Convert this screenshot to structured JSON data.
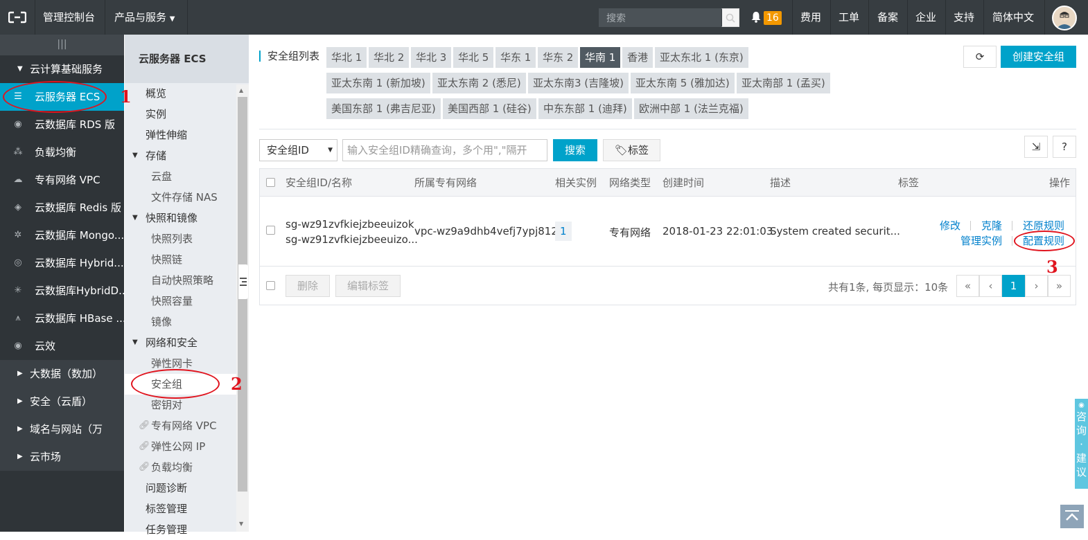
{
  "topbar": {
    "console": "管理控制台",
    "products": "产品与服务",
    "search_placeholder": "搜索",
    "badge_count": "16",
    "links": [
      "费用",
      "工单",
      "备案",
      "企业",
      "支持",
      "简体中文"
    ]
  },
  "leftnav": {
    "grip": "|||",
    "group_title": "云计算基础服务",
    "items": [
      {
        "label": "云服务器 ECS",
        "icon": "server-icon"
      },
      {
        "label": "云数据库 RDS 版",
        "icon": "database-icon"
      },
      {
        "label": "负载均衡",
        "icon": "load-balance-icon"
      },
      {
        "label": "专有网络 VPC",
        "icon": "cloud-icon"
      },
      {
        "label": "云数据库 Redis 版",
        "icon": "redis-icon"
      },
      {
        "label": "云数据库 Mongo...",
        "icon": "mongo-icon"
      },
      {
        "label": "云数据库 Hybrid...",
        "icon": "hybrid-icon"
      },
      {
        "label": "云数据库HybridD...",
        "icon": "hybrid-db-icon"
      },
      {
        "label": "云数据库 HBase ...",
        "icon": "hbase-icon"
      },
      {
        "label": "云效",
        "icon": "eye-icon"
      }
    ],
    "groups": [
      "大数据（数加）",
      "安全（云盾）",
      "域名与网站（万",
      "云市场"
    ]
  },
  "subnav": {
    "title": "云服务器 ECS",
    "items": [
      {
        "label": "概览",
        "level": 1
      },
      {
        "label": "实例",
        "level": 1
      },
      {
        "label": "弹性伸缩",
        "level": 1
      },
      {
        "label": "存储",
        "level": 1,
        "expanded": true
      },
      {
        "label": "云盘",
        "level": 2
      },
      {
        "label": "文件存储 NAS",
        "level": 2
      },
      {
        "label": "快照和镜像",
        "level": 1,
        "expanded": true
      },
      {
        "label": "快照列表",
        "level": 2
      },
      {
        "label": "快照链",
        "level": 2
      },
      {
        "label": "自动快照策略",
        "level": 2
      },
      {
        "label": "快照容量",
        "level": 2
      },
      {
        "label": "镜像",
        "level": 2
      },
      {
        "label": "网络和安全",
        "level": 1,
        "expanded": true
      },
      {
        "label": "弹性网卡",
        "level": 2
      },
      {
        "label": "安全组",
        "level": 2
      },
      {
        "label": "密钥对",
        "level": 2
      },
      {
        "label": "专有网络 VPC",
        "level": 2,
        "link": true
      },
      {
        "label": "弹性公网 IP",
        "level": 2,
        "link": true
      },
      {
        "label": "负载均衡",
        "level": 2,
        "link": true
      },
      {
        "label": "问题诊断",
        "level": 1
      },
      {
        "label": "标签管理",
        "level": 1
      },
      {
        "label": "任务管理",
        "level": 1
      }
    ]
  },
  "main": {
    "region_label": "安全组列表",
    "regions_row1": [
      "华北 1",
      "华北 2",
      "华北 3",
      "华北 5",
      "华东 1",
      "华东 2",
      "华南 1",
      "香港",
      "亚太东北 1 (东京)"
    ],
    "regions_row2": [
      "亚太东南 1 (新加坡)",
      "亚太东南 2 (悉尼)",
      "亚太东南3 (吉隆坡)",
      "亚太东南 5 (雅加达)",
      "亚太南部 1 (孟买)"
    ],
    "regions_row3": [
      "美国东部 1 (弗吉尼亚)",
      "美国西部 1 (硅谷)",
      "中东东部 1 (迪拜)",
      "欧洲中部 1 (法兰克福)"
    ],
    "active_region": "华南 1",
    "create_button": "创建安全组",
    "filter_select": "安全组ID",
    "search_placeholder": "输入安全组ID精确查询，多个用\",\"隔开",
    "search_button": "搜索",
    "tag_button": "标签",
    "columns": [
      "安全组ID/名称",
      "所属专有网络",
      "相关实例",
      "网络类型",
      "创建时间",
      "描述",
      "标签",
      "操作"
    ],
    "row": {
      "id": "sg-wz91zvfkiejzbeeuizok",
      "name": "sg-wz91zvfkiejzbeeuizo...",
      "vpc": "vpc-wz9a9dhb4vefj7ypj8120",
      "instances": "1",
      "network_type": "专有网络",
      "created": "2018-01-23 22:01:03",
      "description": "System created securit...",
      "actions": [
        "修改",
        "克隆",
        "还原规则",
        "管理实例",
        "配置规则"
      ]
    },
    "footer": {
      "delete": "删除",
      "edit_tags": "编辑标签",
      "summary": "共有1条, 每页显示：10条",
      "pages": [
        "«",
        "‹",
        "1",
        "›",
        "»"
      ]
    }
  },
  "annotations": [
    "1",
    "2",
    "3"
  ],
  "feedback": [
    "咨",
    "询",
    "·",
    "建",
    "议"
  ]
}
